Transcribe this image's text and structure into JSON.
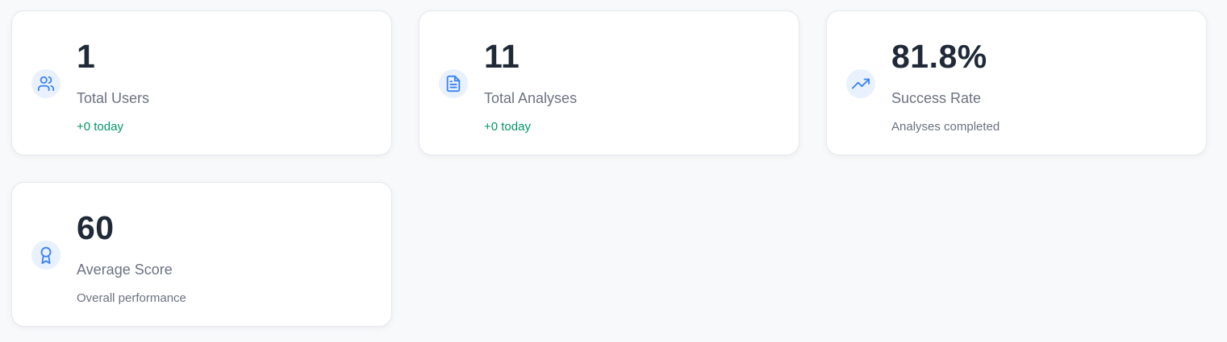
{
  "colors": {
    "accent": "#3b82f6",
    "icon_bg": "#e8f1fd",
    "positive": "#059669",
    "muted": "#6b7280",
    "value": "#1f2937"
  },
  "stats": [
    {
      "icon": "users-icon",
      "value": "1",
      "label": "Total Users",
      "sub": "+0 today",
      "sub_positive": true
    },
    {
      "icon": "document-icon",
      "value": "11",
      "label": "Total Analyses",
      "sub": "+0 today",
      "sub_positive": true
    },
    {
      "icon": "trending-up-icon",
      "value": "81.8%",
      "label": "Success Rate",
      "sub": "Analyses completed",
      "sub_positive": false
    },
    {
      "icon": "award-icon",
      "value": "60",
      "label": "Average Score",
      "sub": "Overall performance",
      "sub_positive": false
    }
  ]
}
